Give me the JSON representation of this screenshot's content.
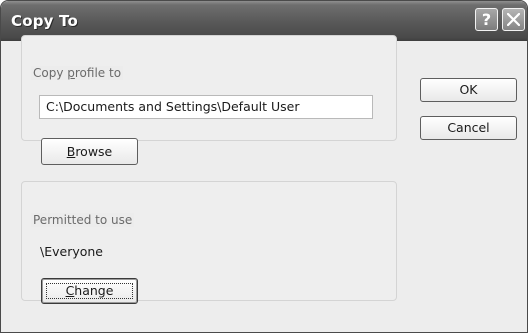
{
  "window": {
    "title": "Copy To",
    "help_label": "?",
    "close_icon": "close-icon"
  },
  "copy_group": {
    "legend": "Copy profile to",
    "path_value": "C:\\Documents and Settings\\Default User",
    "browse_label": "Browse"
  },
  "permit_group": {
    "legend": "Permitted to use",
    "user": "\\Everyone",
    "change_label": "Change"
  },
  "buttons": {
    "ok_label": "OK",
    "cancel_label": "Cancel"
  }
}
